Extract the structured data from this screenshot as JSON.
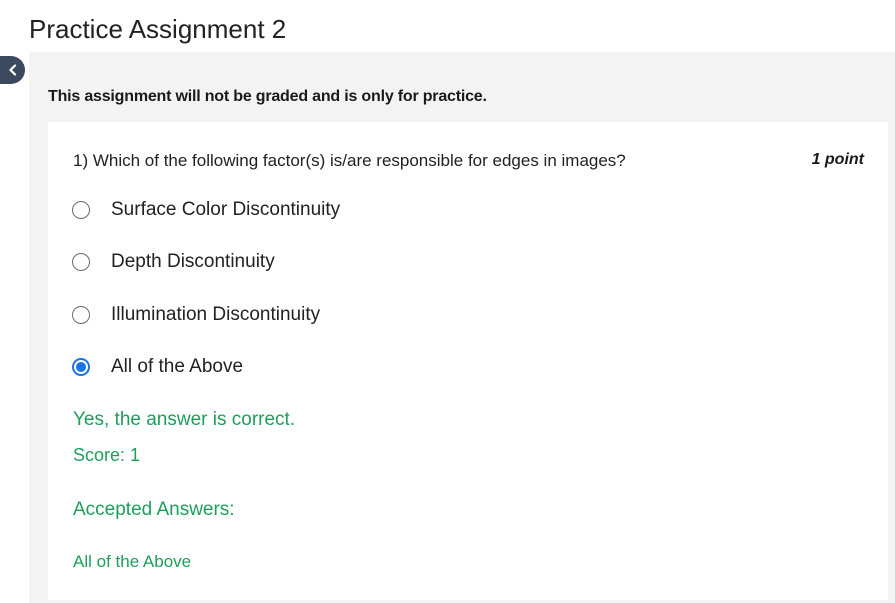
{
  "page": {
    "title": "Practice Assignment 2",
    "notice": "This assignment will not be graded and is only for practice."
  },
  "question": {
    "text": "1) Which of the following factor(s) is/are responsible for edges in images?",
    "points": "1 point",
    "options": [
      {
        "label": "Surface Color Discontinuity",
        "selected": false
      },
      {
        "label": "Depth Discontinuity",
        "selected": false
      },
      {
        "label": "Illumination Discontinuity",
        "selected": false
      },
      {
        "label": "All of the Above",
        "selected": true
      }
    ]
  },
  "feedback": {
    "result": "Yes, the answer is correct.",
    "score": "Score: 1",
    "accepted_heading": "Accepted Answers:",
    "accepted_answer": "All of the Above"
  },
  "colors": {
    "accent": "#1a73e8",
    "success": "#1e9e5a",
    "back_button": "#3b4a5e"
  },
  "icons": {
    "back": "chevron-left-icon"
  }
}
